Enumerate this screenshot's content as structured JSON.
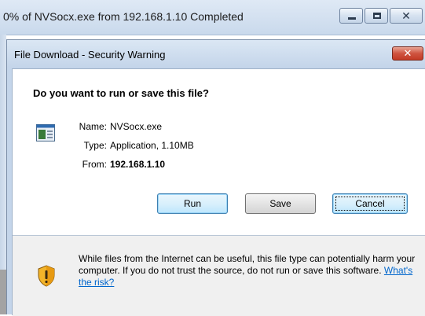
{
  "outer_window": {
    "title": "0% of NVSocx.exe from 192.168.1.10 Completed",
    "buttons": {
      "minimize": "minimize",
      "maximize": "maximize",
      "close_glyph": "✕"
    }
  },
  "dialog": {
    "title": "File Download - Security Warning",
    "close_glyph": "✕",
    "question": "Do you want to run or save this file?",
    "file_icon": "application-icon",
    "info": {
      "name_label": "Name:",
      "name_value": "NVSocx.exe",
      "type_label": "Type:",
      "type_value": "Application, 1.10MB",
      "from_label": "From:",
      "from_value": "192.168.1.10"
    },
    "buttons": {
      "run": "Run",
      "save": "Save",
      "cancel": "Cancel"
    },
    "warning": {
      "icon": "shield-warning-icon",
      "text": "While files from the Internet can be useful, this file type can potentially harm your computer. If you do not trust the source, do not run or save this software.",
      "link": "What's the risk?"
    }
  },
  "colors": {
    "titlebar": "#c9d9ec",
    "close_red": "#c33a25",
    "link": "#0066cc",
    "warning_bg": "#f0f0f0"
  }
}
